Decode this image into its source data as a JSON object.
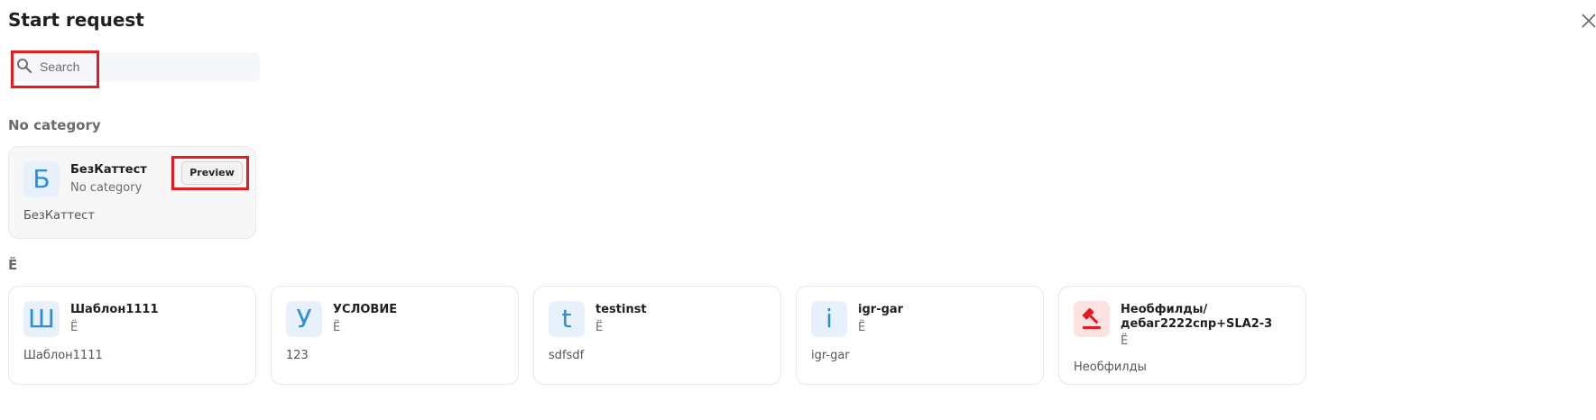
{
  "dialog": {
    "title": "Start request",
    "close_icon": "close-icon"
  },
  "search": {
    "placeholder": "Search",
    "value": ""
  },
  "sections": [
    {
      "title": "No category",
      "cards": [
        {
          "avatar": "Б",
          "name": "БезКаттест",
          "category": "No category",
          "description": "БезКаттест",
          "preview_label": "Preview"
        }
      ]
    },
    {
      "title": "Ё",
      "cards": [
        {
          "avatar": "Ш",
          "name": "Шаблон1111",
          "category": "Ё",
          "description": "Шаблон1111"
        },
        {
          "avatar": "У",
          "name": "УСЛОВИЕ",
          "category": "Ё",
          "description": "123"
        },
        {
          "avatar": "t",
          "name": "testinst",
          "category": "Ё",
          "description": "sdfsdf"
        },
        {
          "avatar": "i",
          "name": "igr-gar",
          "category": "Ё",
          "description": "igr-gar"
        },
        {
          "avatar_icon": "gavel-icon",
          "name": "Необфилды/\nдебаг2222спр+SLA2-3",
          "name_line1": "Необфилды/",
          "name_line2": "дебаг2222спр+SLA2-3",
          "category": "Ё",
          "description": "Необфилды"
        }
      ]
    }
  ],
  "colors": {
    "accent": "#2a8fd4",
    "highlight": "#e31b23",
    "muted": "#6b6b6b"
  }
}
